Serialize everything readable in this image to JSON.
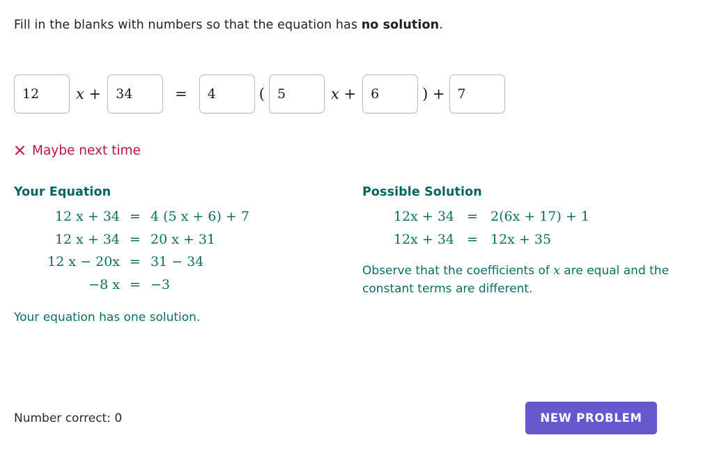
{
  "prompt": {
    "before": "Fill in the blanks with numbers so that the equation has ",
    "emphasis": "no solution",
    "after": "."
  },
  "equation_inputs": {
    "a": "12",
    "b": "34",
    "c": "4",
    "d": "5",
    "e": "6",
    "f": "7",
    "placeholder": "",
    "operators": {
      "x_plus": "x +",
      "equals": "=",
      "open_paren": "(",
      "x_plus2": "x +",
      "close_paren_plus": ") +"
    }
  },
  "verdict": {
    "icon": "x-mark-icon",
    "text": "Maybe next time",
    "color": "#c2103c"
  },
  "your_equation": {
    "title": "Your Equation",
    "lines": [
      {
        "lhs": "12 x + 34",
        "eq": "=",
        "rhs": "4 (5 x + 6) + 7"
      },
      {
        "lhs": "12 x + 34",
        "eq": "=",
        "rhs": "20 x + 31"
      },
      {
        "lhs": "12 x − 20x",
        "eq": "=",
        "rhs": "31 − 34"
      },
      {
        "lhs": "−8 x",
        "eq": "=",
        "rhs": "−3"
      }
    ],
    "conclusion": "Your equation has one solution."
  },
  "possible_solution": {
    "title": "Possible Solution",
    "lines": [
      {
        "lhs": "12x + 34",
        "eq": "=",
        "rhs": "2(6x + 17) + 1"
      },
      {
        "lhs": "12x + 34",
        "eq": "=",
        "rhs": "12x + 35"
      }
    ],
    "note_before": "Observe that the coefficients of ",
    "note_var": "x",
    "note_after": " are equal and the constant terms are different."
  },
  "footer": {
    "score_label": "Number correct: 0",
    "new_problem_label": "NEW PROBLEM",
    "button_color": "#6458cc"
  },
  "theme": {
    "teal": "#0b6e62",
    "teal_heading": "#00665a",
    "red": "#c2103c",
    "purple": "#6458cc"
  }
}
